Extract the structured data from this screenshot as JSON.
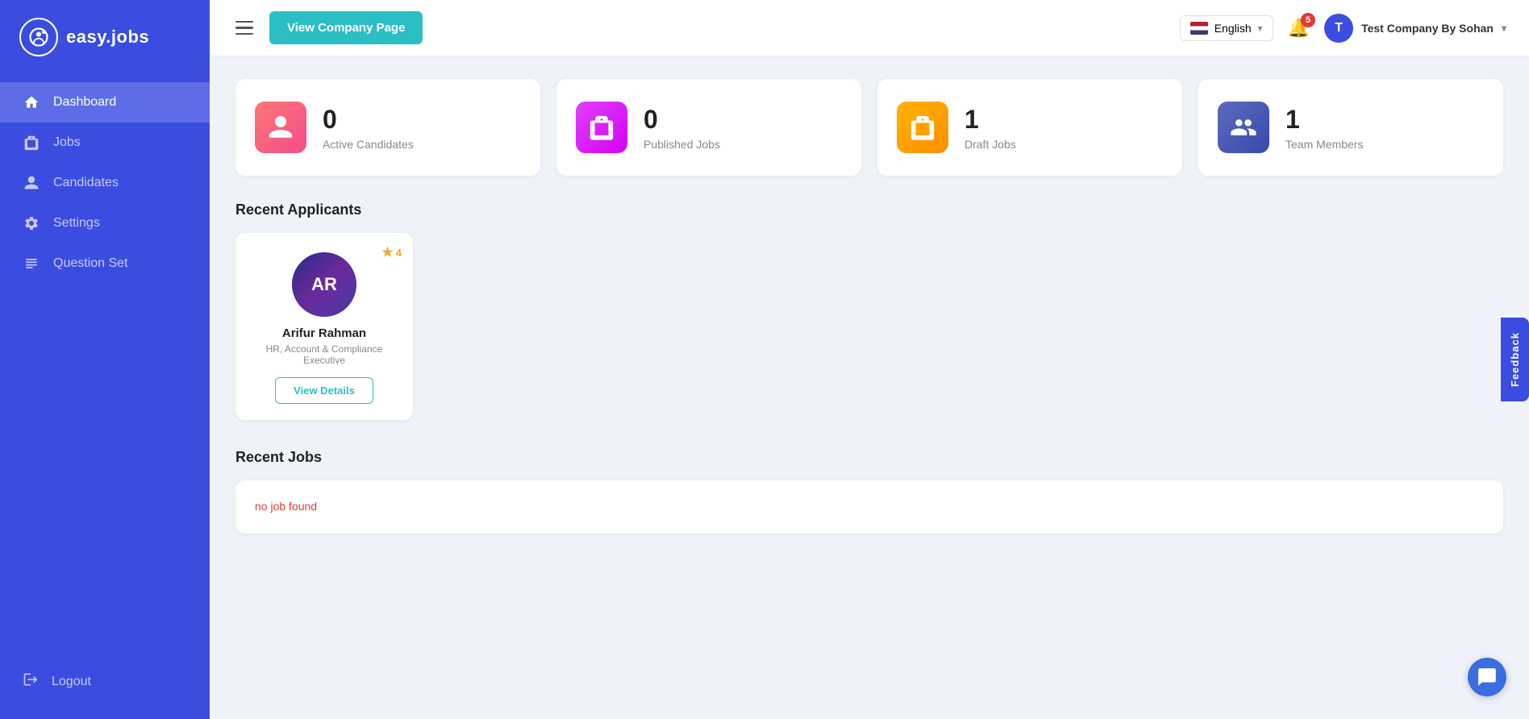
{
  "sidebar": {
    "logo_text": "easy.jobs",
    "nav_items": [
      {
        "id": "dashboard",
        "label": "Dashboard",
        "active": true
      },
      {
        "id": "jobs",
        "label": "Jobs",
        "active": false
      },
      {
        "id": "candidates",
        "label": "Candidates",
        "active": false
      },
      {
        "id": "settings",
        "label": "Settings",
        "active": false
      },
      {
        "id": "question-set",
        "label": "Question Set",
        "active": false
      }
    ],
    "logout_label": "Logout"
  },
  "topbar": {
    "view_company_label": "View Company Page",
    "language": "English",
    "bell_badge": "5",
    "company_name": "Test Company By Sohan"
  },
  "stats": [
    {
      "id": "active-candidates",
      "number": "0",
      "label": "Active Candidates",
      "color": "pink"
    },
    {
      "id": "published-jobs",
      "number": "0",
      "label": "Published Jobs",
      "color": "magenta"
    },
    {
      "id": "draft-jobs",
      "number": "1",
      "label": "Draft Jobs",
      "color": "orange"
    },
    {
      "id": "team-members",
      "number": "1",
      "label": "Team Members",
      "color": "blue"
    }
  ],
  "recent_applicants": {
    "title": "Recent Applicants",
    "items": [
      {
        "id": "arifur-rahman",
        "name": "Arifur Rahman",
        "role": "HR, Account & Compliance Executive",
        "star_rating": "4",
        "view_details_label": "View Details"
      }
    ]
  },
  "recent_jobs": {
    "title": "Recent Jobs",
    "no_job_text": "no job found"
  },
  "feedback": {
    "label": "Feedback"
  }
}
